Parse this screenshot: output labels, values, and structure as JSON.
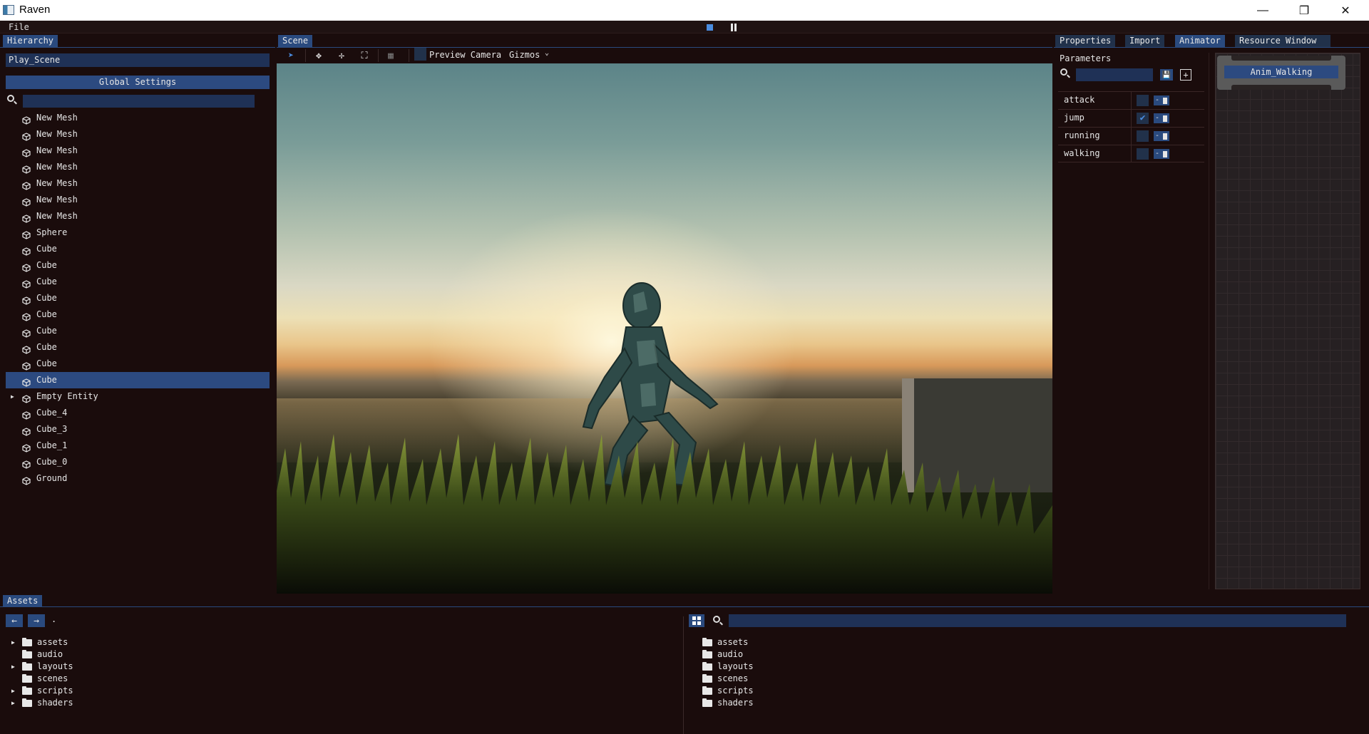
{
  "window": {
    "title": "Raven",
    "minimize": "—",
    "maximize": "❐",
    "close": "✕"
  },
  "menu": {
    "file": "File"
  },
  "hierarchy": {
    "tab": "Hierarchy",
    "scene_name": "Play_Scene",
    "global_settings": "Global Settings",
    "search_placeholder": "",
    "items": [
      {
        "label": "New Mesh",
        "expandable": false,
        "selected": false
      },
      {
        "label": "New Mesh",
        "expandable": false,
        "selected": false
      },
      {
        "label": "New Mesh",
        "expandable": false,
        "selected": false
      },
      {
        "label": "New Mesh",
        "expandable": false,
        "selected": false
      },
      {
        "label": "New Mesh",
        "expandable": false,
        "selected": false
      },
      {
        "label": "New Mesh",
        "expandable": false,
        "selected": false
      },
      {
        "label": "New Mesh",
        "expandable": false,
        "selected": false
      },
      {
        "label": "Sphere",
        "expandable": false,
        "selected": false
      },
      {
        "label": "Cube",
        "expandable": false,
        "selected": false
      },
      {
        "label": "Cube",
        "expandable": false,
        "selected": false
      },
      {
        "label": "Cube",
        "expandable": false,
        "selected": false
      },
      {
        "label": "Cube",
        "expandable": false,
        "selected": false
      },
      {
        "label": "Cube",
        "expandable": false,
        "selected": false
      },
      {
        "label": "Cube",
        "expandable": false,
        "selected": false
      },
      {
        "label": "Cube",
        "expandable": false,
        "selected": false
      },
      {
        "label": "Cube",
        "expandable": false,
        "selected": false
      },
      {
        "label": "Cube",
        "expandable": false,
        "selected": true
      },
      {
        "label": "Empty Entity",
        "expandable": true,
        "selected": false
      },
      {
        "label": "Cube_4",
        "expandable": false,
        "selected": false
      },
      {
        "label": "Cube_3",
        "expandable": false,
        "selected": false
      },
      {
        "label": "Cube_1",
        "expandable": false,
        "selected": false
      },
      {
        "label": "Cube_0",
        "expandable": false,
        "selected": false
      },
      {
        "label": "Ground",
        "expandable": false,
        "selected": false
      }
    ]
  },
  "scene": {
    "tab": "Scene",
    "preview_camera": "Preview Camera",
    "gizmos": "Gizmos",
    "tools": [
      "pointer-icon",
      "move-icon",
      "rotate-icon",
      "scale-icon",
      "grid-icon"
    ]
  },
  "right_tabs": [
    {
      "label": "Properties",
      "active": false
    },
    {
      "label": "Import",
      "active": false
    },
    {
      "label": "Animator",
      "active": true
    },
    {
      "label": "Resource Window",
      "active": false
    }
  ],
  "animator": {
    "parameters_title": "Parameters",
    "search_placeholder": "",
    "parameters": [
      {
        "name": "attack",
        "checked": false
      },
      {
        "name": "jump",
        "checked": true
      },
      {
        "name": "running",
        "checked": false
      },
      {
        "name": "walking",
        "checked": false
      }
    ],
    "node_label": "Anim_Walking"
  },
  "assets": {
    "tab": "Assets",
    "path": ".",
    "search_placeholder": "",
    "tree": [
      {
        "label": "assets",
        "expandable": true
      },
      {
        "label": "audio",
        "expandable": false
      },
      {
        "label": "layouts",
        "expandable": true
      },
      {
        "label": "scenes",
        "expandable": false
      },
      {
        "label": "scripts",
        "expandable": true
      },
      {
        "label": "shaders",
        "expandable": true
      }
    ],
    "grid": [
      "assets",
      "audio",
      "layouts",
      "scenes",
      "scripts",
      "shaders"
    ]
  },
  "colors": {
    "accent": "#2a4a7e",
    "selection": "#2c4a80",
    "background": "#1a0c0c",
    "input": "#1f3156",
    "play_stop": "#4a8ce0"
  }
}
